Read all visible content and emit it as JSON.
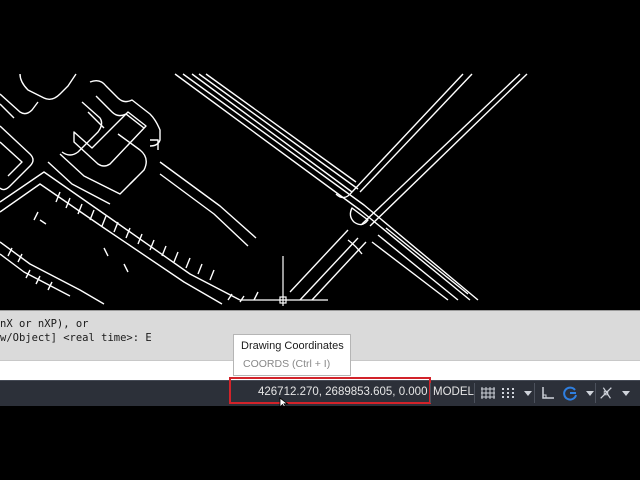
{
  "command_line": {
    "history_line1": "nX or nXP), or",
    "history_line2": "w/Object] <real time>: E"
  },
  "tooltip": {
    "title": "Drawing Coordinates",
    "shortcut": "COORDS (Ctrl + I)"
  },
  "status_bar": {
    "coordinates": "426712.270, 2689853.605, 0.000",
    "space_label": "MODEL",
    "icons": [
      "grid-icon",
      "snap-mode-icon",
      "dropdown-arrow-icon",
      "ortho-mode-icon",
      "polar-tracking-icon",
      "object-snap-icon"
    ]
  },
  "colors": {
    "viewport_background": "#000000",
    "drawing_lines": "#ffffff",
    "status_bar_background": "#2c3039",
    "highlight_box": "#d2232a",
    "polar_icon_blue": "#2f7fe0"
  }
}
